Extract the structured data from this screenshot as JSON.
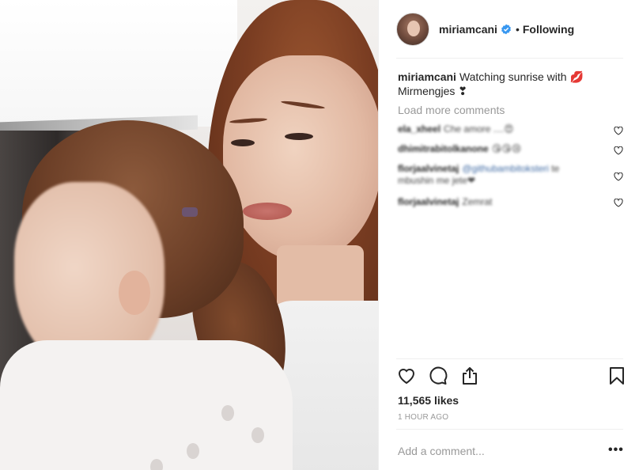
{
  "post": {
    "username": "miriamcani",
    "follow_status": "Following",
    "bullet": "•",
    "caption_text": "Watching sunrise with 💋 Mirmengjes ❣",
    "load_more": "Load more comments",
    "comments": [
      {
        "user": "ela_xheel",
        "text": "Che amore ....😍"
      },
      {
        "user": "dhimitrabitolkanone",
        "text": "😘😘😢"
      },
      {
        "user": "florjaalvinetaj",
        "mention": "@githubambitoksteri",
        "text": "te mbushin me jete❤"
      },
      {
        "user": "florjaalvinetaj",
        "text": "Zemrat"
      }
    ],
    "likes": "11,565 likes",
    "time": "1 HOUR AGO",
    "add_comment_placeholder": "Add a comment...",
    "more_options": "•••"
  },
  "icons": {
    "verified": "verified-badge-icon",
    "like": "heart-icon",
    "comment": "comment-bubble-icon",
    "share": "share-icon",
    "save": "bookmark-icon",
    "comment_like": "small-heart-icon"
  },
  "colors": {
    "verified_blue": "#3897f0",
    "text": "#262626",
    "muted": "#999999",
    "border": "#efefef"
  }
}
